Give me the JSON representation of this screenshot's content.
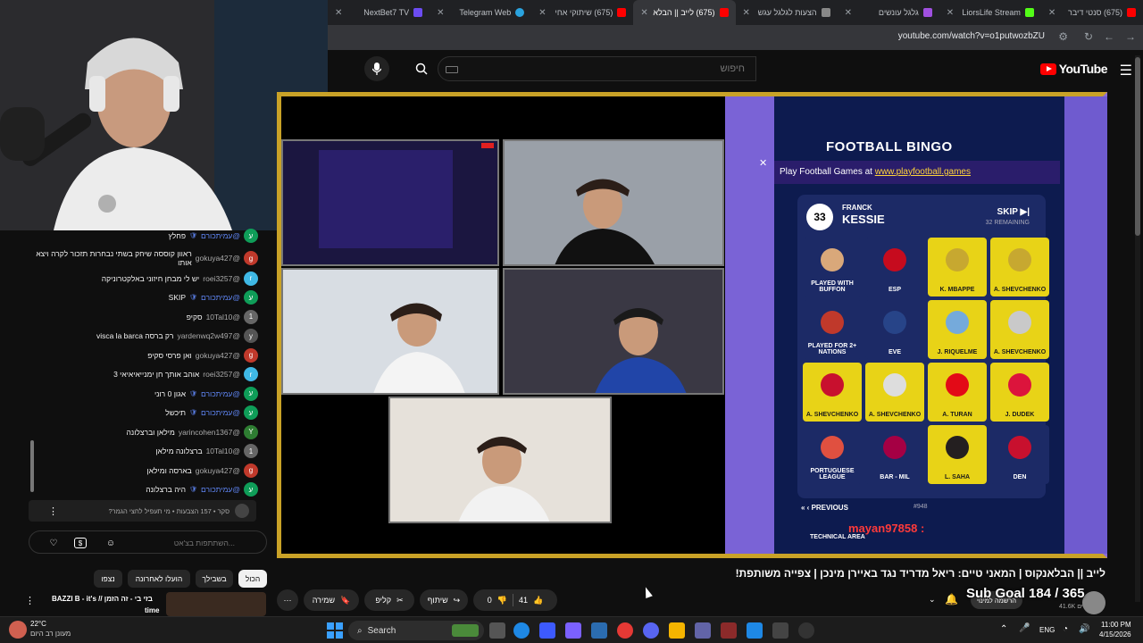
{
  "browser": {
    "tabs": [
      {
        "title": "NextBet7 TV",
        "color": "#6c4cf1",
        "active": false
      },
      {
        "title": "Telegram Web",
        "color": "#2aa3df",
        "active": false
      },
      {
        "title": "(675) שיתוקי אחי",
        "color": "#ff0000",
        "active": false
      },
      {
        "title": "(675) לייב || הבלא",
        "color": "#ff0000",
        "active": true
      },
      {
        "title": "הצעות לגלגל עגש",
        "color": "#888888",
        "active": false
      },
      {
        "title": "גלגל עונשים",
        "color": "#a050e0",
        "active": false
      },
      {
        "title": "LiorsLife Stream",
        "color": "#53fc18",
        "active": false
      },
      {
        "title": "(675) סנטי דיבר",
        "color": "#ff0000",
        "active": false
      }
    ],
    "url": "youtube.com/watch?v=o1putwozbZU"
  },
  "youtube": {
    "logo_text": "YouTube",
    "search_placeholder": "חיפוש"
  },
  "bingo": {
    "title": "FOOTBALL BINGO",
    "subtitle_prefix": "Play Football Games at",
    "subtitle_link": "www.playfootball.games",
    "player_number": "33",
    "player_first": "FRANCK",
    "player_last": "KESSIE",
    "skip_label": "SKIP",
    "remaining": "32 REMAINING",
    "cells": [
      {
        "label": "PLAYED WITH BUFFON",
        "yellow": false,
        "sym": "#d9a87a"
      },
      {
        "label": "ESP",
        "yellow": false,
        "sym": "#c60b1e"
      },
      {
        "label": "K. MBAPPE",
        "yellow": true,
        "sym": "#c7a830"
      },
      {
        "label": "A. SHEVCHENKO",
        "yellow": true,
        "sym": "#c7a830"
      },
      {
        "label": "PLAYED FOR 2+ NATIONS",
        "yellow": false,
        "sym": "#c0392b"
      },
      {
        "label": "EVE",
        "yellow": false,
        "sym": "#274488"
      },
      {
        "label": "J. RIQUELME",
        "yellow": true,
        "sym": "#75aadb"
      },
      {
        "label": "A. SHEVCHENKO",
        "yellow": true,
        "sym": "#c9c9c9"
      },
      {
        "label": "A. SHEVCHENKO",
        "yellow": true,
        "sym": "#c8102e"
      },
      {
        "label": "A. SHEVCHENKO",
        "yellow": true,
        "sym": "#dddddd"
      },
      {
        "label": "A. TURAN",
        "yellow": true,
        "sym": "#e30a17"
      },
      {
        "label": "J. DUDEK",
        "yellow": true,
        "sym": "#dc143c"
      },
      {
        "label": "PORTUGUESE LEAGUE",
        "yellow": false,
        "sym": "#e05040"
      },
      {
        "label": "BAR - MIL",
        "yellow": false,
        "sym": "#a50044"
      },
      {
        "label": "L. SAHA",
        "yellow": true,
        "sym": "#241f20"
      },
      {
        "label": "DEN",
        "yellow": false,
        "sym": "#c8102e"
      }
    ],
    "prev_label": "PREVIOUS",
    "game_no": "#948",
    "tech_area": "TECHNICAL AREA",
    "mayan_tag": "mayan97858 :"
  },
  "chat": {
    "messages": [
      {
        "author": "@עמיתכורם",
        "text": "פחלץ",
        "mod": true,
        "av": "ע",
        "color": "#0f9d58"
      },
      {
        "author": "@gokuya427",
        "text": "ראוון קוססה שיחק בשתי נבחרות תזכור לקרה ויצא אותו",
        "mod": false,
        "av": "g",
        "color": "#c0392b"
      },
      {
        "author": "@roei3257",
        "text": "יש לי מבחן חיזוני באלקטרוניקה",
        "mod": false,
        "av": "r",
        "color": "#3fb8e5"
      },
      {
        "author": "@עמיתכורם",
        "text": "SKIP",
        "mod": true,
        "av": "ע",
        "color": "#0f9d58"
      },
      {
        "author": "@10Tal10",
        "text": "סקיפ",
        "mod": false,
        "av": "1",
        "color": "#666666"
      },
      {
        "author": "@yardenwq2w497",
        "text": "רק ברסה visca la barca",
        "mod": false,
        "av": "y",
        "color": "#555555"
      },
      {
        "author": "@gokuya427",
        "text": "ואן פרסי סקיפ",
        "mod": false,
        "av": "g",
        "color": "#c0392b"
      },
      {
        "author": "@roei3257",
        "text": "אוהב אותך חן ימנייאיאיאי 3",
        "mod": false,
        "av": "r",
        "color": "#3fb8e5"
      },
      {
        "author": "@עמיתכורם",
        "text": "אגון 0 רוני",
        "mod": true,
        "av": "ע",
        "color": "#0f9d58"
      },
      {
        "author": "@עמיתכורם",
        "text": "תיכשל",
        "mod": true,
        "av": "ע",
        "color": "#0f9d58"
      },
      {
        "author": "@yarincohen1367",
        "text": "מילאן וברצלונה",
        "mod": false,
        "av": "Y",
        "color": "#2e7d32"
      },
      {
        "author": "@10Tal10",
        "text": "ברצלונה מילאן",
        "mod": false,
        "av": "1",
        "color": "#666666"
      },
      {
        "author": "@gokuya427",
        "text": "בארסה ומילאן",
        "mod": false,
        "av": "g",
        "color": "#c0392b"
      },
      {
        "author": "@עמיתכורם",
        "text": "היה ברצלונה",
        "mod": true,
        "av": "ע",
        "color": "#0f9d58"
      }
    ],
    "pinned": "סקר • 157 הצבעות • מי תעפיל לחצי הגמר?",
    "input_placeholder": "השתתפות בצ'אט..."
  },
  "video": {
    "title": "לייב || הבלאנקוס | המאני טיים: ריאל מדריד נגד באיירן מינכן | צפייה משותפת!",
    "like_count": "41",
    "dislike_count": "0",
    "share_label": "שיתוף",
    "clip_label": "קליפ",
    "save_label": "שמירה",
    "subgoal": "Sub Goal 184 / 365",
    "subscribe_label": "הרשמה למינוי",
    "subs_count": "41.6K מנויים"
  },
  "filters": [
    "הכול",
    "בשבילך",
    "הועלו לאחרונה",
    "נצפו"
  ],
  "next_video": {
    "title": "BAZZI B - it's // בזי בי - זה הזמן",
    "sub": "time"
  },
  "taskbar": {
    "temp": "22°C",
    "weather_desc": "מעונן רב היום",
    "search_label": "Search",
    "lang": "ENG",
    "time": "11:00 PM",
    "date": "4/15/2026"
  }
}
